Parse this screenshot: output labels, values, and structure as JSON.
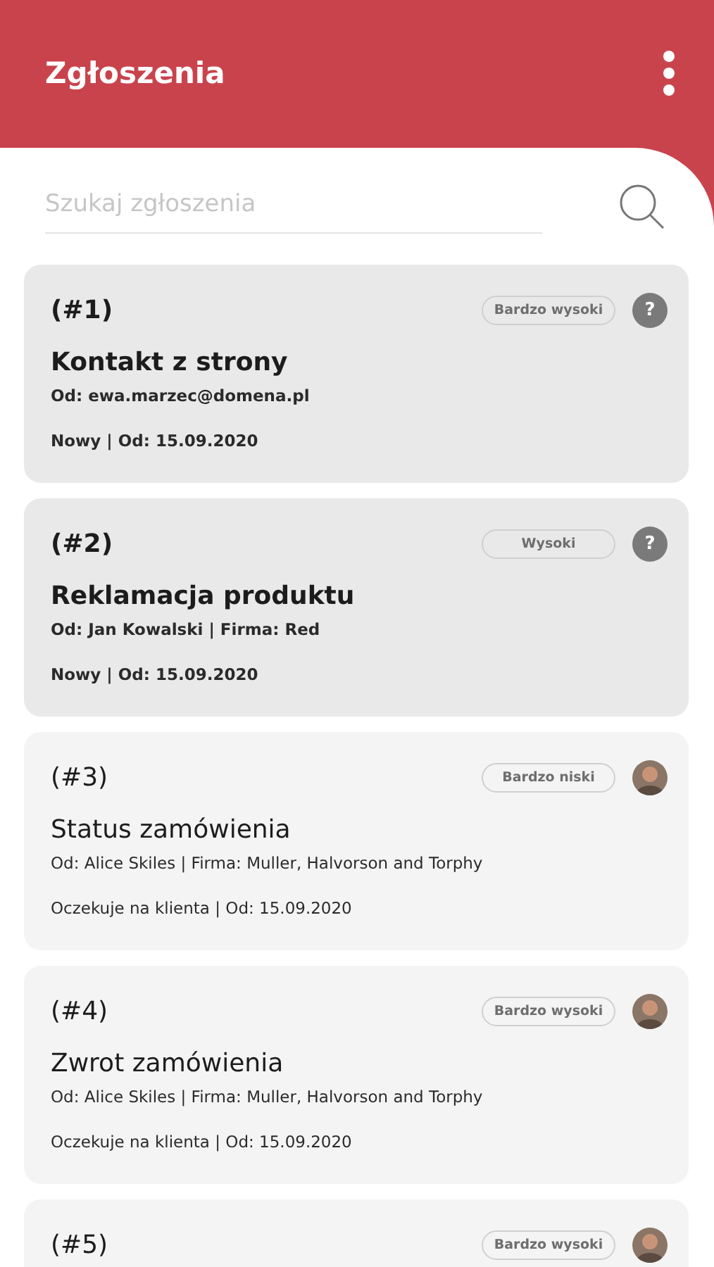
{
  "header": {
    "title": "Zgłoszenia"
  },
  "search": {
    "placeholder": "Szukaj zgłoszenia"
  },
  "tickets": [
    {
      "number": "(#1)",
      "priority": "Bardzo wysoki",
      "unread": true,
      "assignee": {
        "kind": "unassigned",
        "label": "?"
      },
      "title": "Kontakt z strony",
      "from": "Od: ewa.marzec@domena.pl",
      "status": "Nowy | Od: 15.09.2020"
    },
    {
      "number": "(#2)",
      "priority": "Wysoki",
      "unread": true,
      "assignee": {
        "kind": "unassigned",
        "label": "?"
      },
      "title": "Reklamacja produktu",
      "from": "Od: Jan Kowalski | Firma: Red",
      "status": "Nowy | Od: 15.09.2020"
    },
    {
      "number": "(#3)",
      "priority": "Bardzo niski",
      "unread": false,
      "assignee": {
        "kind": "avatar"
      },
      "title": "Status zamówienia",
      "from": "Od: Alice Skiles | Firma: Muller, Halvorson and Torphy",
      "status": "Oczekuje na klienta | Od: 15.09.2020"
    },
    {
      "number": "(#4)",
      "priority": "Bardzo wysoki",
      "unread": false,
      "assignee": {
        "kind": "avatar"
      },
      "title": "Zwrot zamówienia",
      "from": "Od: Alice Skiles | Firma: Muller, Halvorson and Torphy",
      "status": "Oczekuje na klienta | Od: 15.09.2020"
    },
    {
      "number": "(#5)",
      "priority": "Bardzo wysoki",
      "unread": false,
      "assignee": {
        "kind": "avatar"
      }
    }
  ]
}
